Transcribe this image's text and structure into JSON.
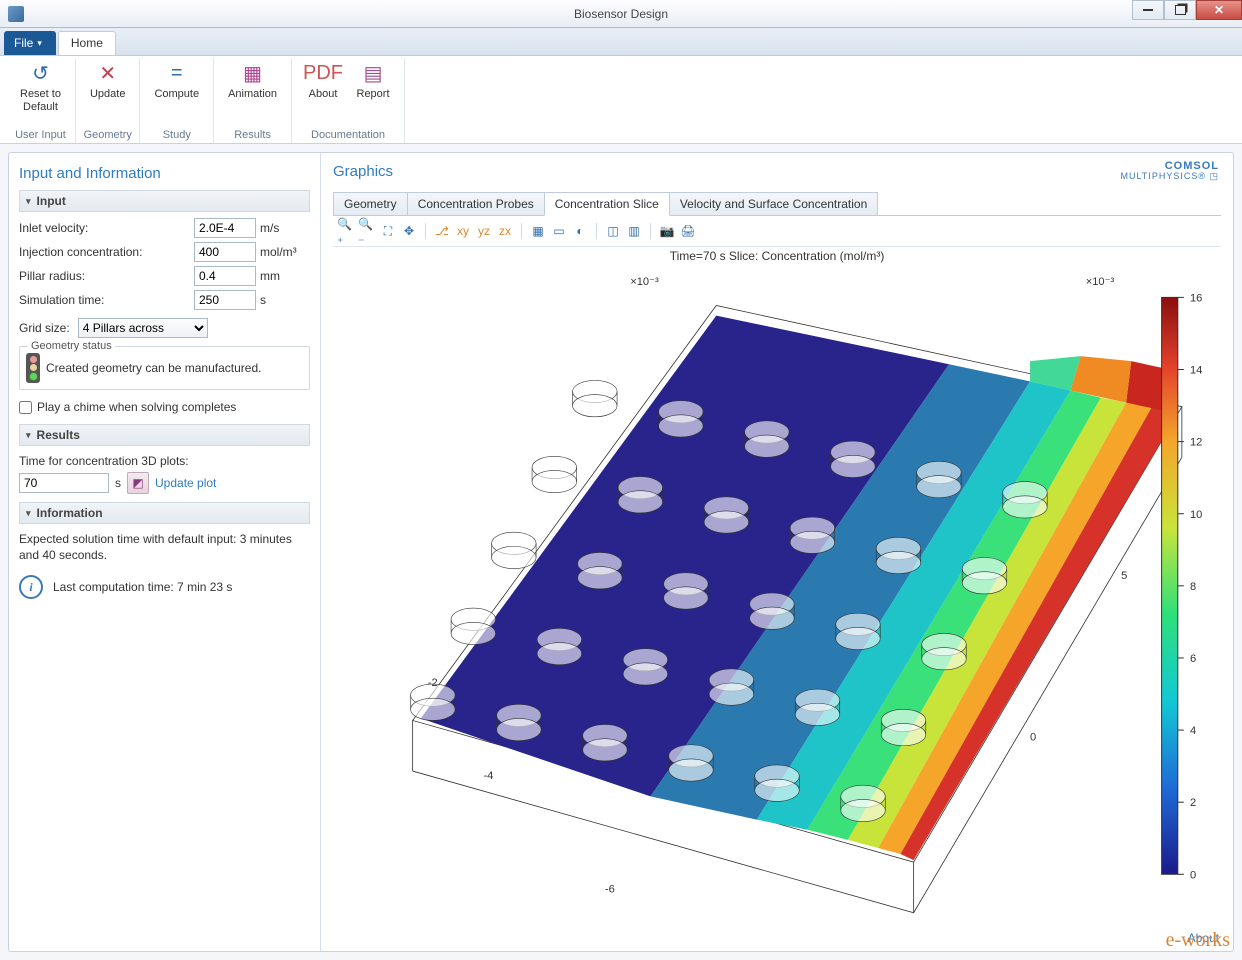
{
  "window": {
    "title": "Biosensor Design"
  },
  "menubar": {
    "file": "File",
    "tabs": [
      "Home"
    ]
  },
  "ribbon": {
    "groups": [
      {
        "name": "User Input",
        "buttons": [
          {
            "label": "Reset to\nDefault",
            "icon": "undo-icon",
            "glyph": "↺",
            "color": "#2e6cad"
          }
        ]
      },
      {
        "name": "Geometry",
        "buttons": [
          {
            "label": "Update",
            "icon": "compass-icon",
            "glyph": "✕",
            "color": "#c04050"
          }
        ]
      },
      {
        "name": "Study",
        "buttons": [
          {
            "label": "Compute",
            "icon": "equals-icon",
            "glyph": "=",
            "color": "#2e6cad"
          }
        ]
      },
      {
        "name": "Results",
        "buttons": [
          {
            "label": "Animation",
            "icon": "film-icon",
            "glyph": "▦",
            "color": "#b04090"
          }
        ]
      },
      {
        "name": "Documentation",
        "buttons": [
          {
            "label": "About",
            "icon": "pdf-icon",
            "glyph": "PDF",
            "color": "#c55"
          },
          {
            "label": "Report",
            "icon": "report-icon",
            "glyph": "▤",
            "color": "#a04a8a"
          }
        ]
      }
    ]
  },
  "left": {
    "title": "Input and Information",
    "input_header": "Input",
    "fields": {
      "inlet_velocity": {
        "label": "Inlet velocity:",
        "value": "2.0E-4",
        "unit": "m/s"
      },
      "injection_concentration": {
        "label": "Injection concentration:",
        "value": "400",
        "unit": "mol/m³"
      },
      "pillar_radius": {
        "label": "Pillar radius:",
        "value": "0.4",
        "unit": "mm"
      },
      "simulation_time": {
        "label": "Simulation time:",
        "value": "250",
        "unit": "s"
      },
      "grid_size": {
        "label": "Grid size:",
        "value": "4 Pillars across"
      }
    },
    "geometry_status": {
      "legend": "Geometry status",
      "text": "Created geometry can be manufactured."
    },
    "chime": {
      "label": "Play a chime when solving completes",
      "checked": false
    },
    "results_header": "Results",
    "results": {
      "plot_time_label": "Time for concentration 3D plots:",
      "plot_time_value": "70",
      "plot_time_unit": "s",
      "update_link": "Update plot"
    },
    "info_header": "Information",
    "info": {
      "expected": "Expected solution time with default input: 3 minutes and 40 seconds.",
      "last": "Last computation time: 7 min 23 s"
    }
  },
  "graphics": {
    "title": "Graphics",
    "logo_top": "COMSOL",
    "logo_bottom": "MULTIPHYSICS®",
    "tabs": [
      "Geometry",
      "Concentration Probes",
      "Concentration Slice",
      "Velocity and Surface Concentration"
    ],
    "active_tab": 2,
    "toolbar": [
      "zoom-in-icon",
      "zoom-out-icon",
      "zoom-box-icon",
      "zoom-extents-icon",
      "|",
      "axis-default-icon",
      "xy-icon",
      "yz-icon",
      "zx-icon",
      "|",
      "grid-icon",
      "select-icon",
      "scene-light-icon",
      "|",
      "transparency-icon",
      "wireframe-icon",
      "|",
      "camera-icon",
      "print-icon"
    ],
    "plot_title": "Time=70 s   Slice: Concentration (mol/m³)",
    "colorbar": {
      "min": 0,
      "max": 16,
      "ticks": [
        0,
        2,
        4,
        6,
        8,
        10,
        12,
        14,
        16
      ]
    },
    "axis_exp_y": "×10⁻³",
    "axis_exp_x": "×10⁻³",
    "x_ticks": [
      -2,
      -4,
      -6
    ],
    "y_ticks": [
      0,
      5
    ],
    "footer_link": "About"
  },
  "watermark": "e-works"
}
